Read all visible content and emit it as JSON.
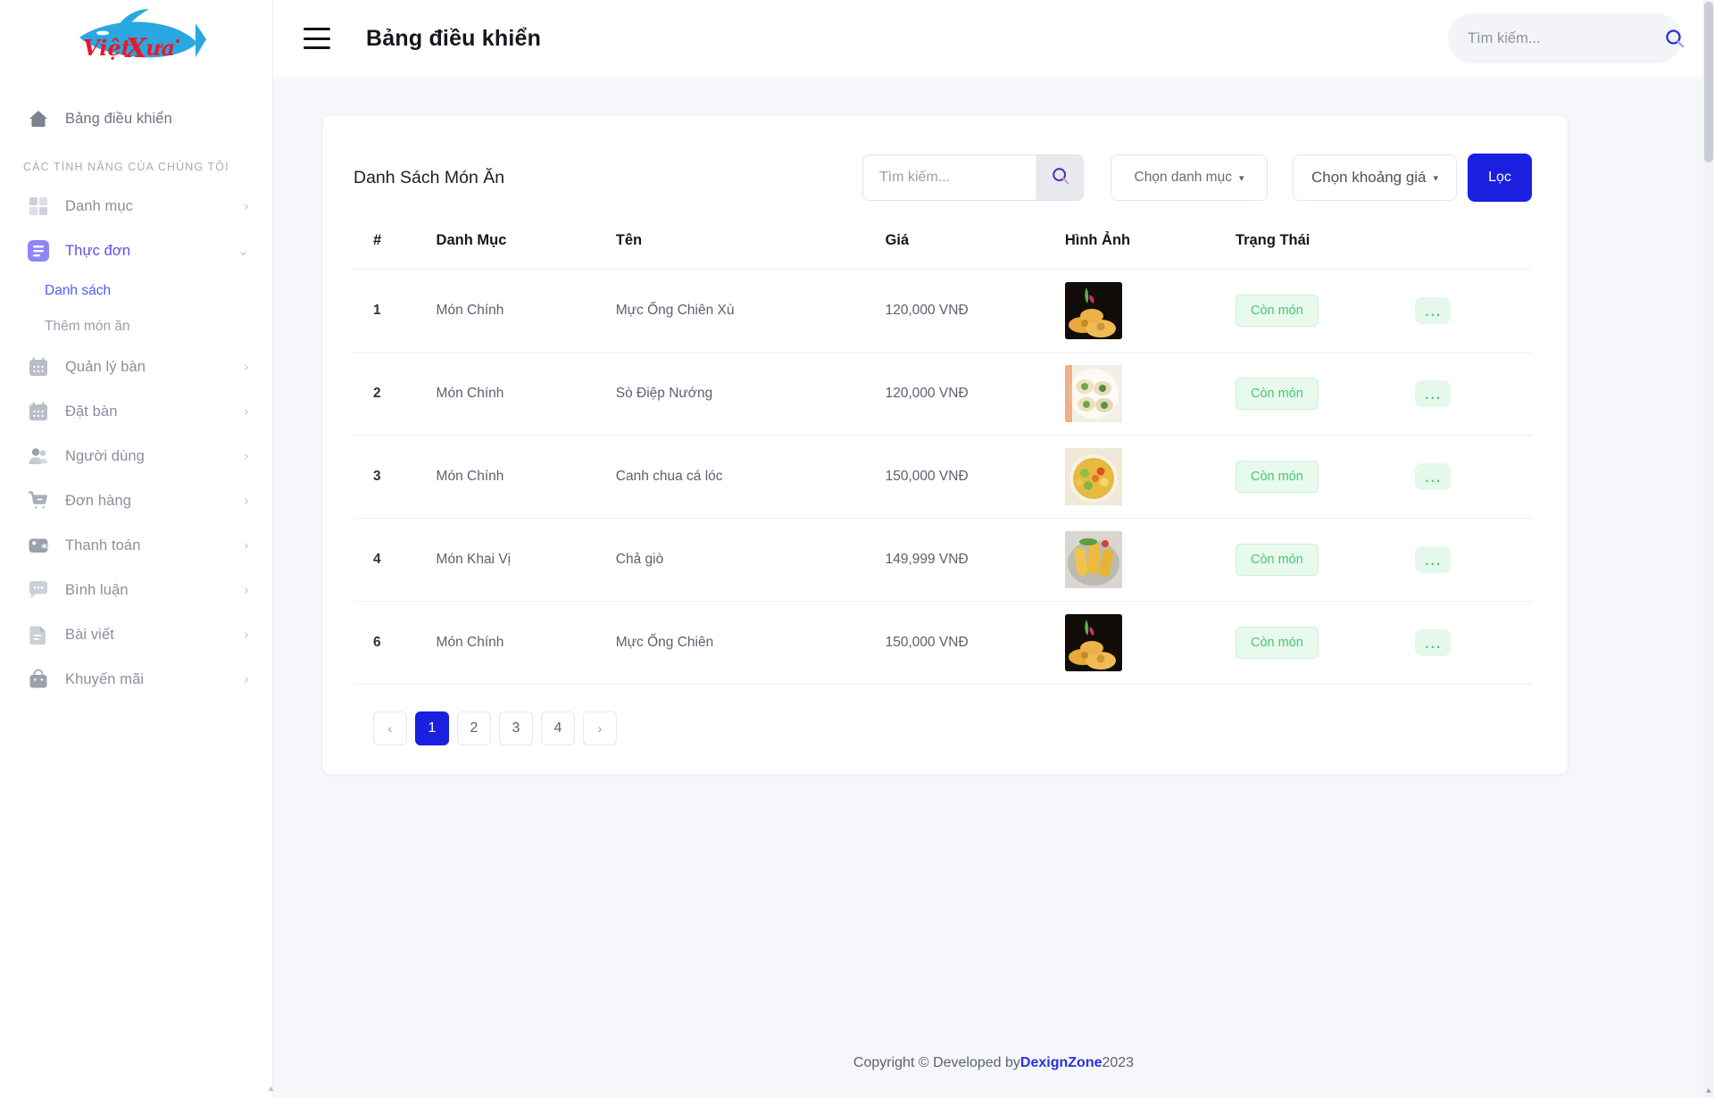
{
  "brand": {
    "name_viet": "Việt",
    "name_xua": "Xưa",
    "colors": {
      "fish": "#29a8e0",
      "text": "#e8192c"
    }
  },
  "header": {
    "title": "Bảng điều khiển",
    "menu_icon": "hamburger-icon",
    "search": {
      "placeholder": "Tìm kiếm...",
      "value": "",
      "icon": "search-icon"
    }
  },
  "sidebar": {
    "home": {
      "label": "Bảng điều khiển",
      "icon": "home-icon"
    },
    "section_title": "CÁC TÍNH NĂNG CỦA CHÚNG TÔI",
    "items": [
      {
        "label": "Danh mục",
        "icon": "grid-icon",
        "chevron": "›",
        "active": false
      },
      {
        "label": "Thực đơn",
        "icon": "menu-list-icon",
        "chevron": "⌄",
        "active": true
      },
      {
        "label": "Quản lý bàn",
        "icon": "calendar-icon",
        "chevron": "›",
        "active": false
      },
      {
        "label": "Đặt bàn",
        "icon": "calendar-icon",
        "chevron": "›",
        "active": false
      },
      {
        "label": "Người dùng",
        "icon": "users-icon",
        "chevron": "›",
        "active": false
      },
      {
        "label": "Đơn hàng",
        "icon": "cart-icon",
        "chevron": "›",
        "active": false
      },
      {
        "label": "Thanh toán",
        "icon": "wallet-icon",
        "chevron": "›",
        "active": false
      },
      {
        "label": "Bình luận",
        "icon": "comment-icon",
        "chevron": "›",
        "active": false
      },
      {
        "label": "Bài viết",
        "icon": "document-icon",
        "chevron": "›",
        "active": false
      },
      {
        "label": "Khuyến mãi",
        "icon": "bag-icon",
        "chevron": "›",
        "active": false
      }
    ],
    "submenu": [
      {
        "label": "Danh sách",
        "active": true
      },
      {
        "label": "Thêm món ăn",
        "active": false
      }
    ]
  },
  "card": {
    "title": "Danh Sách Món Ăn",
    "search": {
      "placeholder": "Tìm kiếm...",
      "value": "",
      "icon": "search-icon"
    },
    "category_select": {
      "label": "Chọn danh mục",
      "caret": "▾"
    },
    "price_select": {
      "label": "Chọn khoảng giá",
      "caret": "▾"
    },
    "filter_button": "Lọc"
  },
  "table": {
    "columns": [
      "#",
      "Danh Mục",
      "Tên",
      "Giá",
      "Hình Ảnh",
      "Trạng Thái",
      ""
    ],
    "rows": [
      {
        "idx": "1",
        "category": "Món Chính",
        "name": "Mực Ống Chiên Xù",
        "price": "120,000 VNĐ",
        "image": "fried-squid-photo",
        "status": "Còn món",
        "action": "…"
      },
      {
        "idx": "2",
        "category": "Món Chính",
        "name": "Sò Điệp Nướng",
        "price": "120,000 VNĐ",
        "image": "grilled-scallop-photo",
        "status": "Còn món",
        "action": "…"
      },
      {
        "idx": "3",
        "category": "Món Chính",
        "name": "Canh chua cá lóc",
        "price": "150,000 VNĐ",
        "image": "sour-soup-photo",
        "status": "Còn món",
        "action": "…"
      },
      {
        "idx": "4",
        "category": "Món Khai Vị",
        "name": "Chả giò",
        "price": "149,999 VNĐ",
        "image": "spring-roll-photo",
        "status": "Còn món",
        "action": "…"
      },
      {
        "idx": "6",
        "category": "Món Chính",
        "name": "Mực Ống Chiên",
        "price": "150,000 VNĐ",
        "image": "fried-squid-photo",
        "status": "Còn món",
        "action": "…"
      }
    ]
  },
  "pagination": {
    "prev": "‹",
    "pages": [
      "1",
      "2",
      "3",
      "4"
    ],
    "active": "1",
    "next": "›"
  },
  "footer": {
    "prefix": "Copyright © Developed by ",
    "link": "DexignZone",
    "suffix": " 2023"
  },
  "accent": {
    "blue": "#1b1fe0",
    "indigo": "#5b4ef0",
    "green": "#4ac66f"
  }
}
